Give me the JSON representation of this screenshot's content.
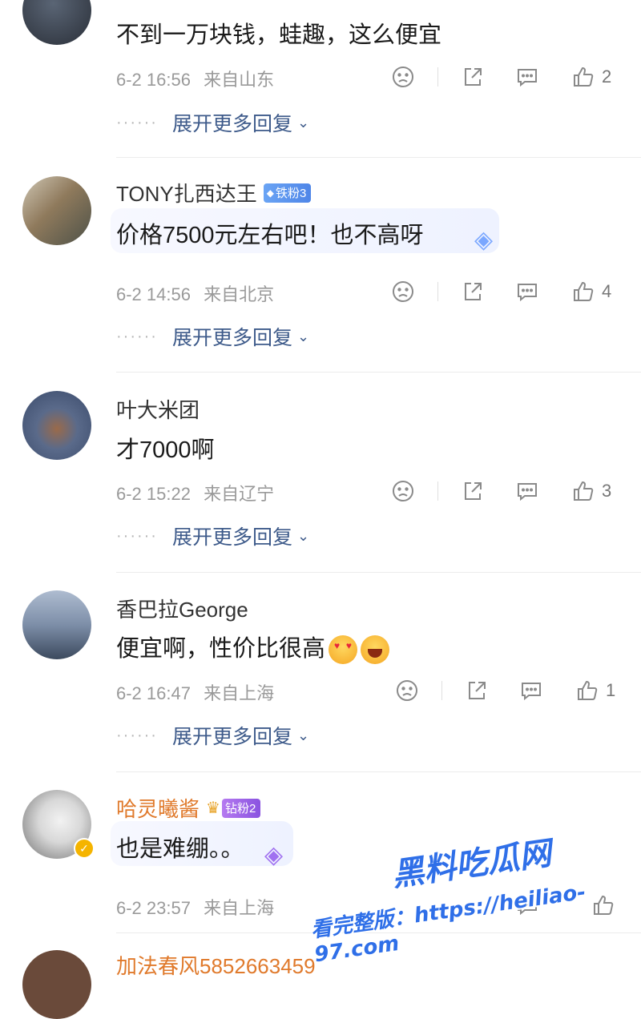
{
  "comments": [
    {
      "name": "",
      "text": "不到一万块钱，蛙趣，这么便宜",
      "date": "6-2 16:56",
      "location": "来自山东",
      "likes": "2",
      "expand": "展开更多回复"
    },
    {
      "name": "TONY扎西达王",
      "badge": "铁粉3",
      "text": "价格7500元左右吧！也不高呀",
      "date": "6-2 14:56",
      "location": "来自北京",
      "likes": "4",
      "expand": "展开更多回复"
    },
    {
      "name": "叶大米团",
      "text": "才7000啊",
      "date": "6-2 15:22",
      "location": "来自辽宁",
      "likes": "3",
      "expand": "展开更多回复"
    },
    {
      "name": "香巴拉George",
      "text": "便宜啊，性价比很高",
      "date": "6-2 16:47",
      "location": "来自上海",
      "likes": "1",
      "expand": "展开更多回复"
    },
    {
      "name": "哈灵曦酱",
      "badge": "钻粉2",
      "text": "也是难绷。。",
      "date": "6-2 23:57",
      "location": "来自上海",
      "likes": ""
    },
    {
      "name": "加法春风5852663459"
    }
  ],
  "watermark": {
    "title": "黑料吃瓜网",
    "url_label": "看完整版：https://heiliao-97.com"
  },
  "icons": {
    "dislike": "dislike-face-icon",
    "share": "share-icon",
    "reply": "comment-bubble-icon",
    "like": "thumbs-up-icon",
    "expand": "chevron-down-icon"
  },
  "colors": {
    "vip_name": "#e07a2c",
    "link": "#3d5a8a",
    "meta": "#9a9a9a"
  }
}
